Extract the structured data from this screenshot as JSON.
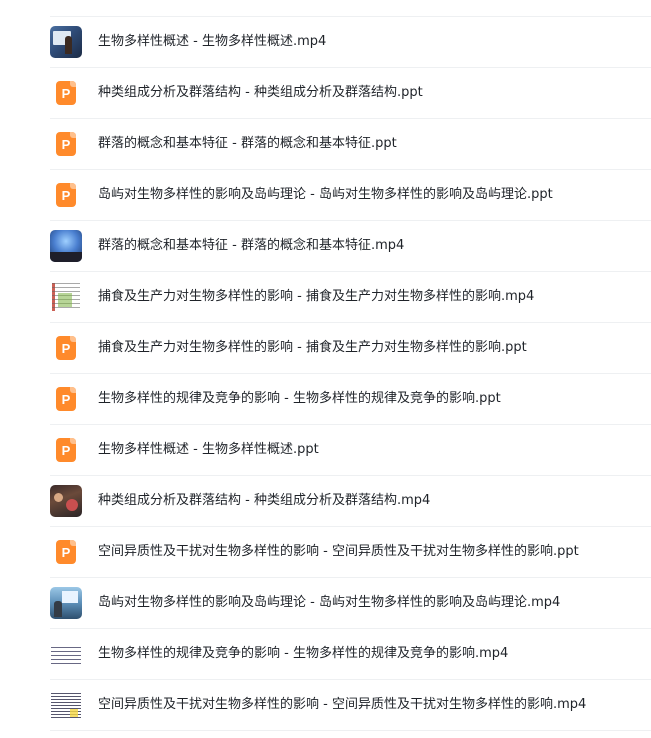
{
  "file_list": {
    "items": [
      {
        "name": "生物多样性概述 - 生物多样性概述.mp4",
        "type": "mp4",
        "thumb": "classroom"
      },
      {
        "name": "种类组成分析及群落结构 - 种类组成分析及群落结构.ppt",
        "type": "ppt",
        "icon": "P"
      },
      {
        "name": "群落的概念和基本特征 - 群落的概念和基本特征.ppt",
        "type": "ppt",
        "icon": "P"
      },
      {
        "name": "岛屿对生物多样性的影响及岛屿理论 - 岛屿对生物多样性的影响及岛屿理论.ppt",
        "type": "ppt",
        "icon": "P"
      },
      {
        "name": "群落的概念和基本特征 - 群落的概念和基本特征.mp4",
        "type": "mp4",
        "thumb": "stage"
      },
      {
        "name": "捕食及生产力对生物多样性的影响 - 捕食及生产力对生物多样性的影响.mp4",
        "type": "mp4",
        "thumb": "doc"
      },
      {
        "name": "捕食及生产力对生物多样性的影响 - 捕食及生产力对生物多样性的影响.ppt",
        "type": "ppt",
        "icon": "P"
      },
      {
        "name": "生物多样性的规律及竞争的影响 - 生物多样性的规律及竞争的影响.ppt",
        "type": "ppt",
        "icon": "P"
      },
      {
        "name": "生物多样性概述 - 生物多样性概述.ppt",
        "type": "ppt",
        "icon": "P"
      },
      {
        "name": "种类组成分析及群落结构 - 种类组成分析及群落结构.mp4",
        "type": "mp4",
        "thumb": "people"
      },
      {
        "name": "空间异质性及干扰对生物多样性的影响 - 空间异质性及干扰对生物多样性的影响.ppt",
        "type": "ppt",
        "icon": "P"
      },
      {
        "name": "岛屿对生物多样性的影响及岛屿理论 - 岛屿对生物多样性的影响及岛屿理论.mp4",
        "type": "mp4",
        "thumb": "lecture"
      },
      {
        "name": "生物多样性的规律及竞争的影响 - 生物多样性的规律及竞争的影响.mp4",
        "type": "mp4",
        "thumb": "text"
      },
      {
        "name": "空间异质性及干扰对生物多样性的影响 - 空间异质性及干扰对生物多样性的影响.mp4",
        "type": "mp4",
        "thumb": "text2"
      }
    ]
  },
  "colors": {
    "ppt_icon": "#ff8a2b",
    "divider": "#eef0f2",
    "text": "#1f2329"
  }
}
